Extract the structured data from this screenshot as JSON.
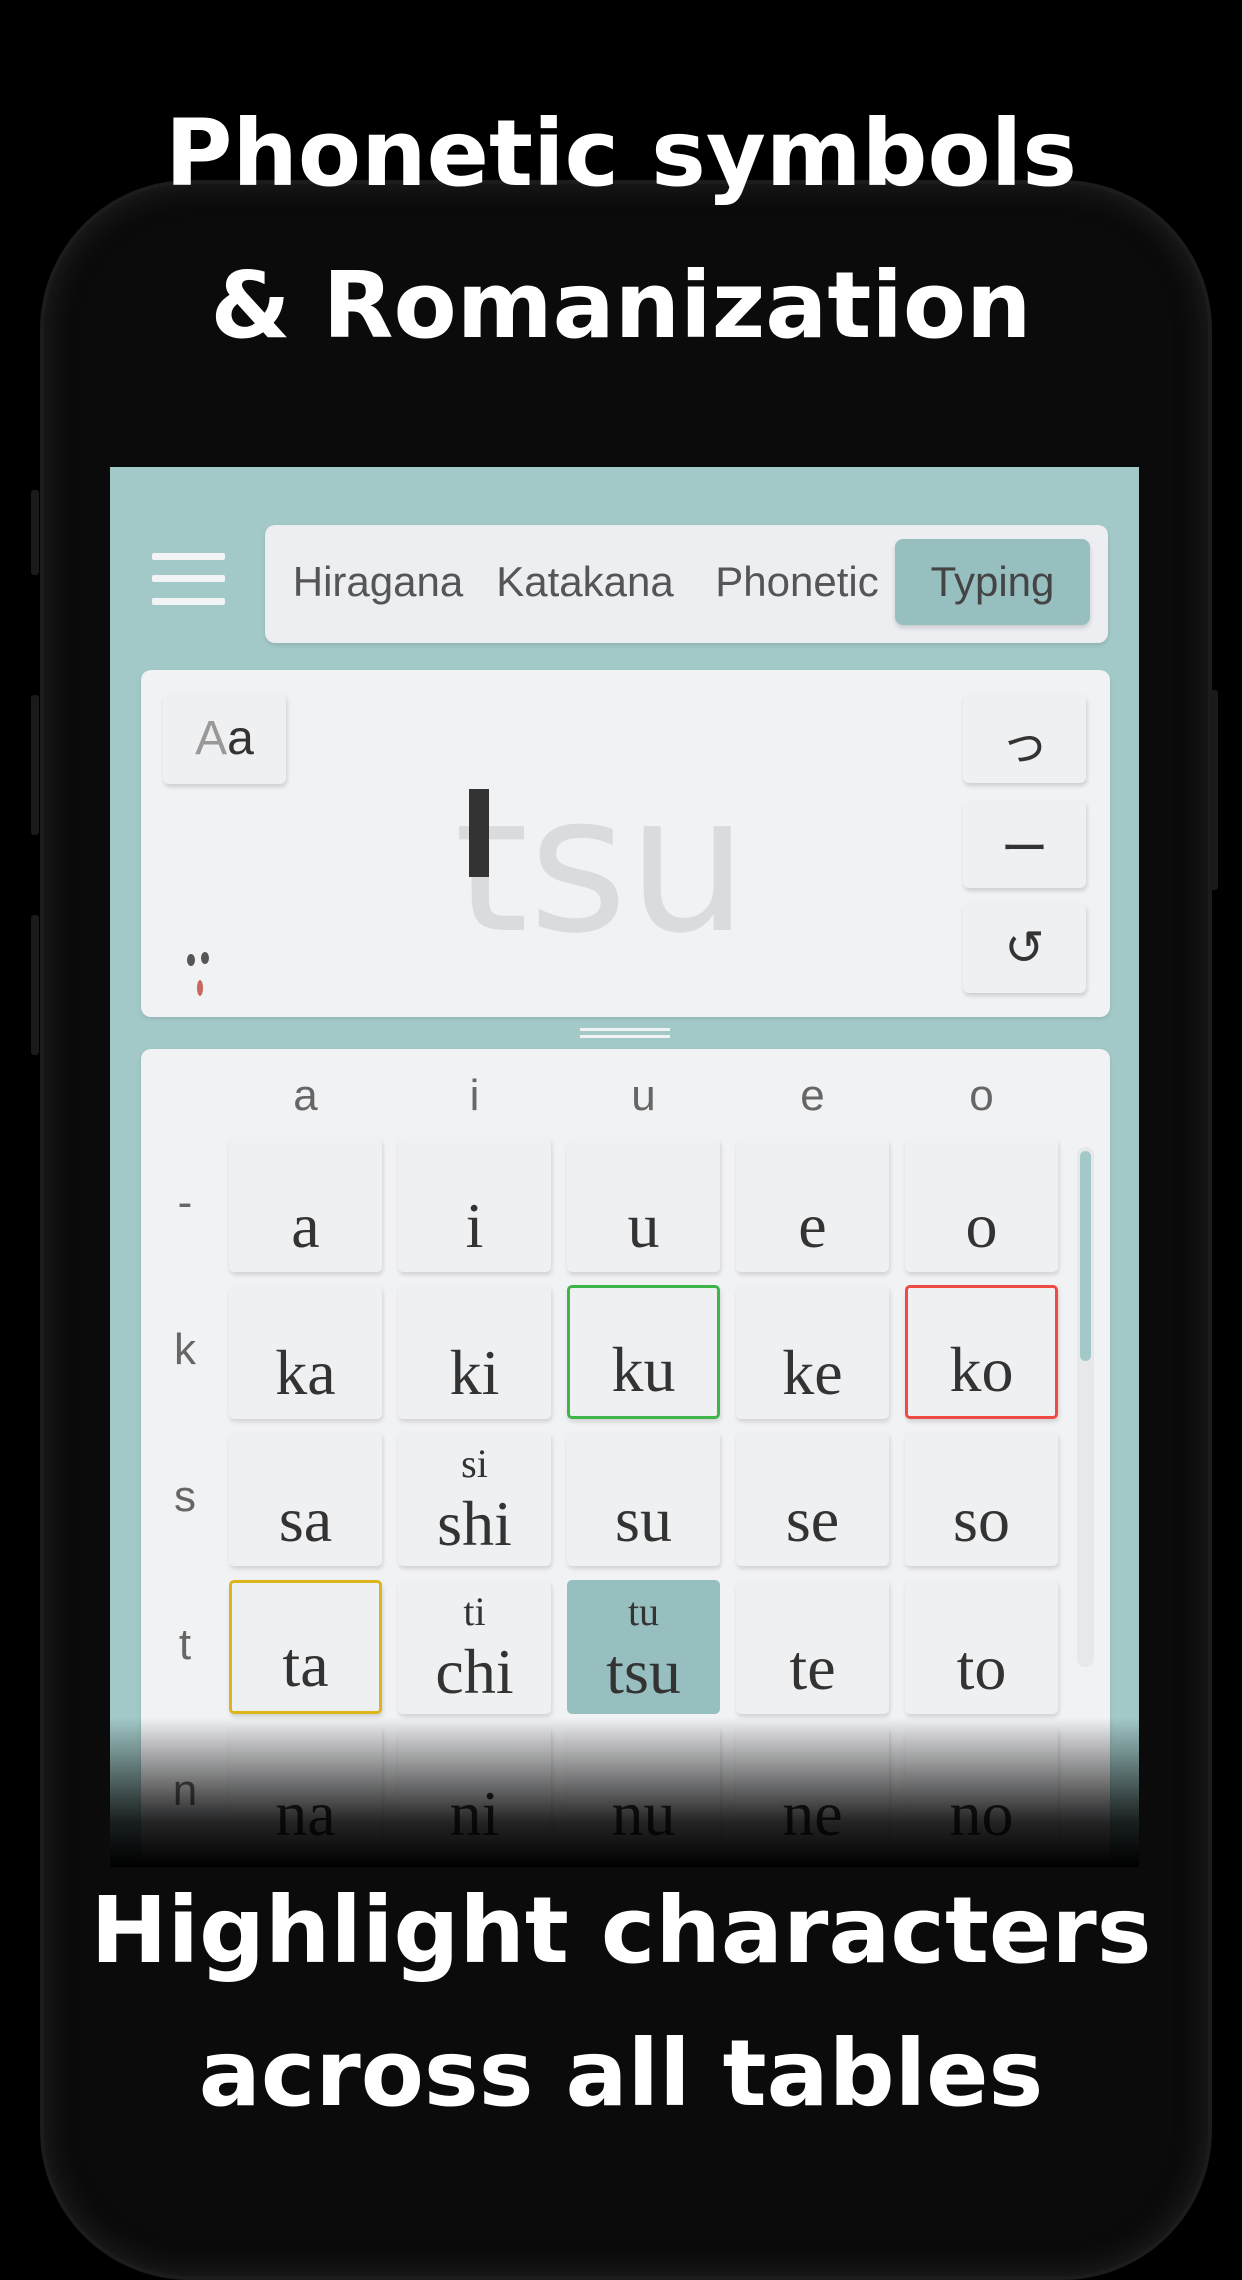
{
  "headline_top": [
    "Phonetic symbols",
    "&  Romanization"
  ],
  "headline_bottom": [
    "Highlight characters",
    "across all tables"
  ],
  "tabs": [
    {
      "label": "Hiragana"
    },
    {
      "label": "Katakana"
    },
    {
      "label": "Phonetic"
    },
    {
      "label": "Typing",
      "active": true
    }
  ],
  "input": {
    "case_toggle_upper": "A",
    "case_toggle_lower": "a",
    "typed_text": "tsu",
    "buttons": [
      "tsu-kana",
      "long-vowel-dash",
      "undo"
    ],
    "kana_label": "っ",
    "dash_label": "ー",
    "undo_label": "↺"
  },
  "table": {
    "columns": [
      "a",
      "i",
      "u",
      "e",
      "o"
    ],
    "rows": [
      {
        "label": "-",
        "cells": [
          {
            "main": "a"
          },
          {
            "main": "i"
          },
          {
            "main": "u"
          },
          {
            "main": "e"
          },
          {
            "main": "o"
          }
        ]
      },
      {
        "label": "k",
        "cells": [
          {
            "main": "ka"
          },
          {
            "main": "ki"
          },
          {
            "main": "ku",
            "highlight": "#3cb64a"
          },
          {
            "main": "ke"
          },
          {
            "main": "ko",
            "highlight": "#ef4a45"
          }
        ]
      },
      {
        "label": "s",
        "cells": [
          {
            "main": "sa"
          },
          {
            "main": "shi",
            "sub": "si"
          },
          {
            "main": "su"
          },
          {
            "main": "se"
          },
          {
            "main": "so"
          }
        ]
      },
      {
        "label": "t",
        "cells": [
          {
            "main": "ta",
            "highlight": "#dcb41c"
          },
          {
            "main": "chi",
            "sub": "ti"
          },
          {
            "main": "tsu",
            "sub": "tu",
            "selected": true
          },
          {
            "main": "te"
          },
          {
            "main": "to"
          }
        ]
      },
      {
        "label": "n",
        "cells": [
          {
            "main": "na"
          },
          {
            "main": "ni"
          },
          {
            "main": "nu"
          },
          {
            "main": "ne"
          },
          {
            "main": "no"
          }
        ]
      }
    ]
  },
  "colors": {
    "accent": "#a2c9c8",
    "selected": "#98bfbf",
    "panel": "#f1f2f4"
  }
}
